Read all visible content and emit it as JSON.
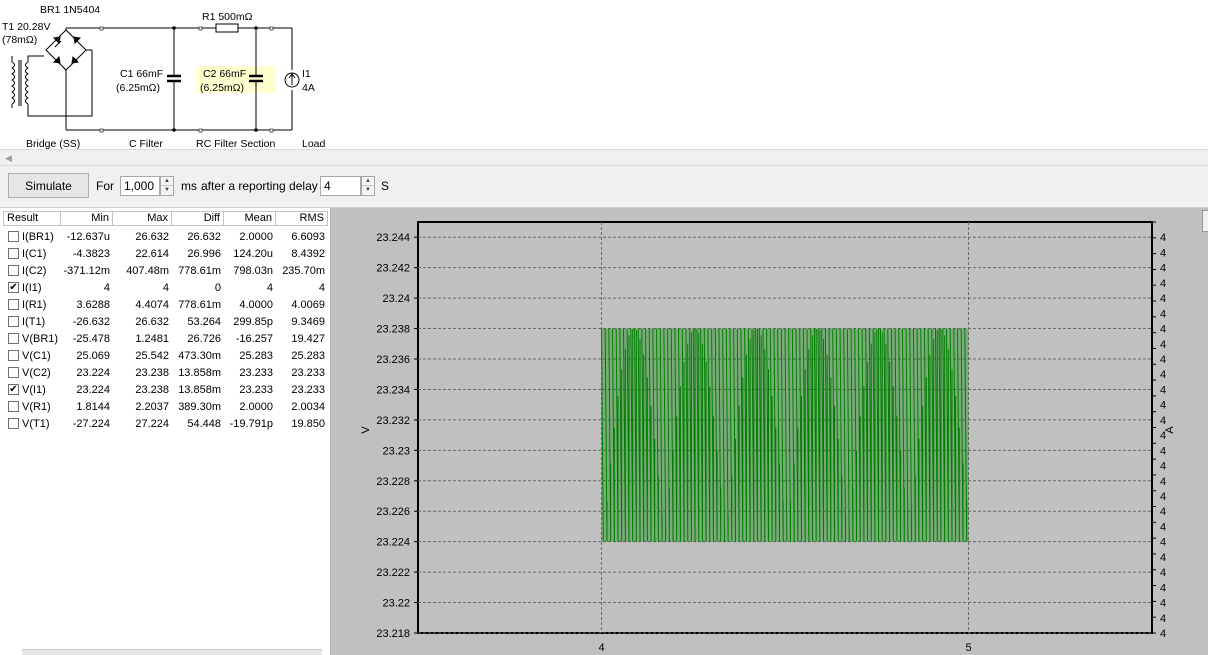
{
  "schematic": {
    "transformer": {
      "name": "T1 20.28V",
      "esr": "(78mΩ)"
    },
    "bridge": {
      "name": "BR1 1N5404",
      "section_label": "Bridge (SS)"
    },
    "c1": {
      "name": "C1 66mF",
      "esr": "(6.25mΩ)",
      "section_label": "C Filter"
    },
    "r1": {
      "name": "R1 500mΩ"
    },
    "c2": {
      "name": "C2 66mF",
      "esr": "(6.25mΩ)",
      "section_label": "RC Filter Section"
    },
    "i1": {
      "name": "I1",
      "value": "4A",
      "section_label": "Load"
    }
  },
  "toolbar": {
    "simulate_label": "Simulate",
    "for_label": "For",
    "duration_value": "1,000",
    "duration_unit": "ms",
    "delay_label": "after a reporting delay of",
    "delay_value": "4",
    "delay_unit": "S"
  },
  "results": {
    "headers": {
      "result": "Result",
      "min": "Min",
      "max": "Max",
      "diff": "Diff",
      "mean": "Mean",
      "rms": "RMS"
    },
    "rows": [
      {
        "name": "I(BR1)",
        "checked": false,
        "min": "-12.637u",
        "max": "26.632",
        "diff": "26.632",
        "mean": "2.0000",
        "rms": "6.6093"
      },
      {
        "name": "I(C1)",
        "checked": false,
        "min": "-4.3823",
        "max": "22.614",
        "diff": "26.996",
        "mean": "124.20u",
        "rms": "8.4392"
      },
      {
        "name": "I(C2)",
        "checked": false,
        "min": "-371.12m",
        "max": "407.48m",
        "diff": "778.61m",
        "mean": "798.03n",
        "rms": "235.70m"
      },
      {
        "name": "I(I1)",
        "checked": true,
        "min": "4",
        "max": "4",
        "diff": "0",
        "mean": "4",
        "rms": "4"
      },
      {
        "name": "I(R1)",
        "checked": false,
        "min": "3.6288",
        "max": "4.4074",
        "diff": "778.61m",
        "mean": "4.0000",
        "rms": "4.0069"
      },
      {
        "name": "I(T1)",
        "checked": false,
        "min": "-26.632",
        "max": "26.632",
        "diff": "53.264",
        "mean": "299.85p",
        "rms": "9.3469"
      },
      {
        "name": "V(BR1)",
        "checked": false,
        "min": "-25.478",
        "max": "1.2481",
        "diff": "26.726",
        "mean": "-16.257",
        "rms": "19.427"
      },
      {
        "name": "V(C1)",
        "checked": false,
        "min": "25.069",
        "max": "25.542",
        "diff": "473.30m",
        "mean": "25.283",
        "rms": "25.283"
      },
      {
        "name": "V(C2)",
        "checked": false,
        "min": "23.224",
        "max": "23.238",
        "diff": "13.858m",
        "mean": "23.233",
        "rms": "23.233"
      },
      {
        "name": "V(I1)",
        "checked": true,
        "min": "23.224",
        "max": "23.238",
        "diff": "13.858m",
        "mean": "23.233",
        "rms": "23.233"
      },
      {
        "name": "V(R1)",
        "checked": false,
        "min": "1.8144",
        "max": "2.2037",
        "diff": "389.30m",
        "mean": "2.0000",
        "rms": "2.0034"
      },
      {
        "name": "V(T1)",
        "checked": false,
        "min": "-27.224",
        "max": "27.224",
        "diff": "54.448",
        "mean": "-19.791p",
        "rms": "19.850"
      }
    ]
  },
  "chart_data": {
    "type": "line",
    "xlabel": "",
    "ylabel": "V",
    "y2label": "A",
    "xlim": [
      3.5,
      5.5
    ],
    "ylim": [
      23.218,
      23.245
    ],
    "x_ticks": [
      "4",
      "5"
    ],
    "y_ticks": [
      "23.244",
      "23.242",
      "23.24",
      "23.238",
      "23.236",
      "23.234",
      "23.232",
      "23.23",
      "23.228",
      "23.226",
      "23.224",
      "23.222",
      "23.22",
      "23.218"
    ],
    "y2_tick_label": "4",
    "grid": true,
    "series": [
      {
        "name": "V(I1)",
        "color": "#008000",
        "x_range": [
          4,
          5
        ],
        "min": 23.224,
        "max": 23.238,
        "ripple_frequency_hz": 100,
        "beat_cycles": 6
      },
      {
        "name": "I(I1)",
        "color": "#008000",
        "value": 4
      }
    ]
  },
  "colors": {
    "trace": "#008000",
    "plot_bg": "#c0c0c0",
    "highlight": "#ffffd0"
  }
}
